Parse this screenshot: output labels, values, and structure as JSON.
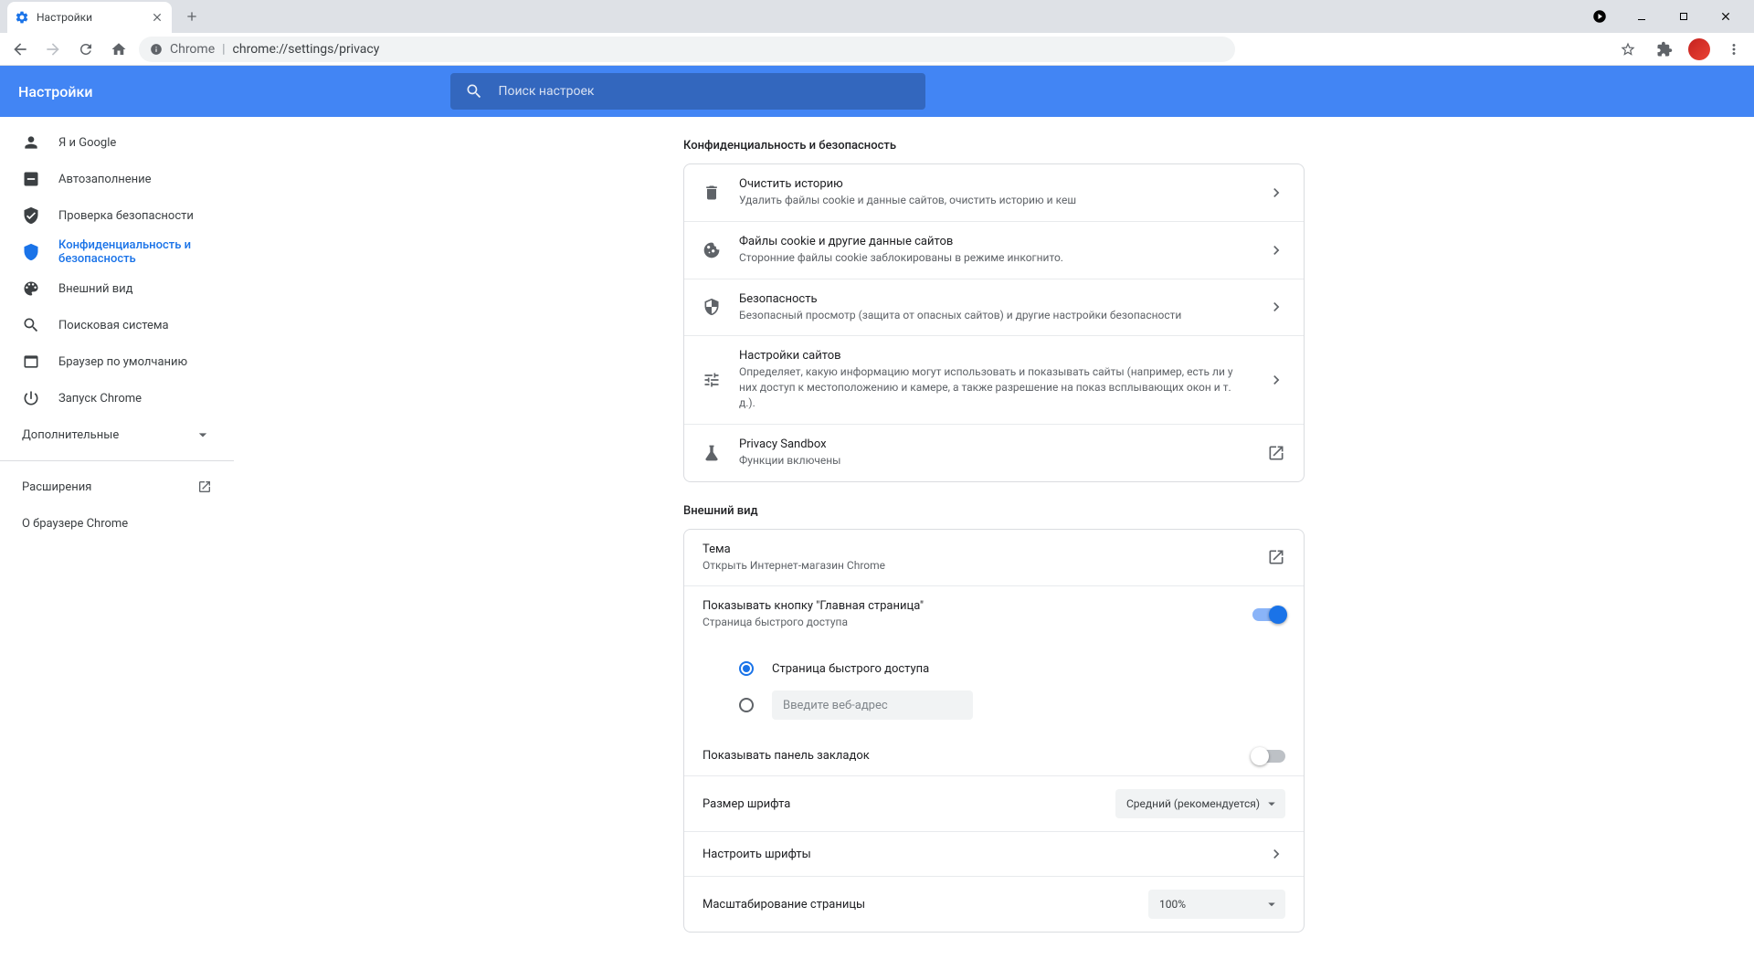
{
  "tab": {
    "title": "Настройки"
  },
  "omnibox": {
    "label": "Chrome",
    "url": "chrome://settings/privacy"
  },
  "header": {
    "title": "Настройки",
    "search_placeholder": "Поиск настроек"
  },
  "sidebar": {
    "items": [
      {
        "label": "Я и Google"
      },
      {
        "label": "Автозаполнение"
      },
      {
        "label": "Проверка безопасности"
      },
      {
        "label": "Конфиденциальность и безопасность"
      },
      {
        "label": "Внешний вид"
      },
      {
        "label": "Поисковая система"
      },
      {
        "label": "Браузер по умолчанию"
      },
      {
        "label": "Запуск Chrome"
      }
    ],
    "advanced": "Дополнительные",
    "extensions": "Расширения",
    "about": "О браузере Chrome"
  },
  "privacy": {
    "title": "Конфиденциальность и безопасность",
    "rows": [
      {
        "title": "Очистить историю",
        "sub": "Удалить файлы cookie и данные сайтов, очистить историю и кеш"
      },
      {
        "title": "Файлы cookie и другие данные сайтов",
        "sub": "Сторонние файлы cookie заблокированы в режиме инкогнито."
      },
      {
        "title": "Безопасность",
        "sub": "Безопасный просмотр (защита от опасных сайтов) и другие настройки безопасности"
      },
      {
        "title": "Настройки сайтов",
        "sub": "Определяет, какую информацию могут использовать и показывать сайты (например, есть ли у них доступ к местоположению и камере, а также разрешение на показ всплывающих окон и т. д.)."
      },
      {
        "title": "Privacy Sandbox",
        "sub": "Функции включены"
      }
    ]
  },
  "appearance": {
    "title": "Внешний вид",
    "theme": {
      "title": "Тема",
      "sub": "Открыть Интернет-магазин Chrome"
    },
    "home_button": {
      "title": "Показывать кнопку \"Главная страница\"",
      "sub": "Страница быстрого доступа"
    },
    "radio": {
      "option1": "Страница быстрого доступа",
      "placeholder": "Введите веб-адрес"
    },
    "bookmarks_bar": "Показывать панель закладок",
    "font_size": {
      "label": "Размер шрифта",
      "value": "Средний (рекомендуется)"
    },
    "customize_fonts": "Настроить шрифты",
    "zoom": {
      "label": "Масштабирование страницы",
      "value": "100%"
    }
  }
}
